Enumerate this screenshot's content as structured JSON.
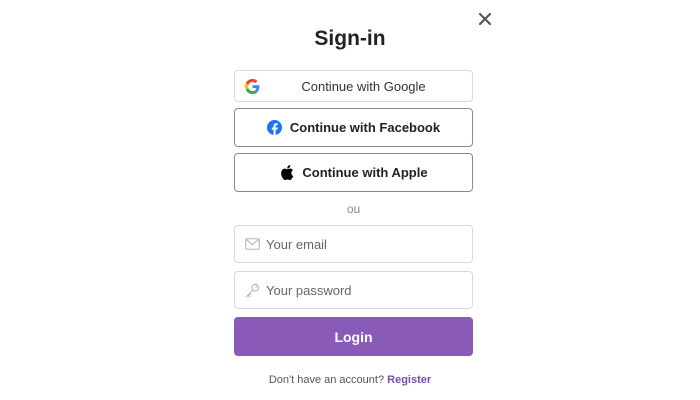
{
  "modal": {
    "title": "Sign-in",
    "close_icon": "close-icon"
  },
  "social": {
    "google_label": "Continue with Google",
    "facebook_label": "Continue with Facebook",
    "apple_label": "Continue with Apple",
    "google_icon": "google-icon",
    "facebook_icon": "facebook-icon",
    "apple_icon": "apple-icon"
  },
  "divider": {
    "text": "ou"
  },
  "form": {
    "email_placeholder": "Your email",
    "email_value": "",
    "email_icon": "envelope-icon",
    "password_placeholder": "Your password",
    "password_value": "",
    "password_icon": "key-icon",
    "login_label": "Login"
  },
  "footer": {
    "prompt": "Don't have an account?",
    "register_label": "Register"
  },
  "colors": {
    "accent": "#8a5ab8",
    "link": "#7b4cab",
    "facebook": "#1877f2"
  }
}
